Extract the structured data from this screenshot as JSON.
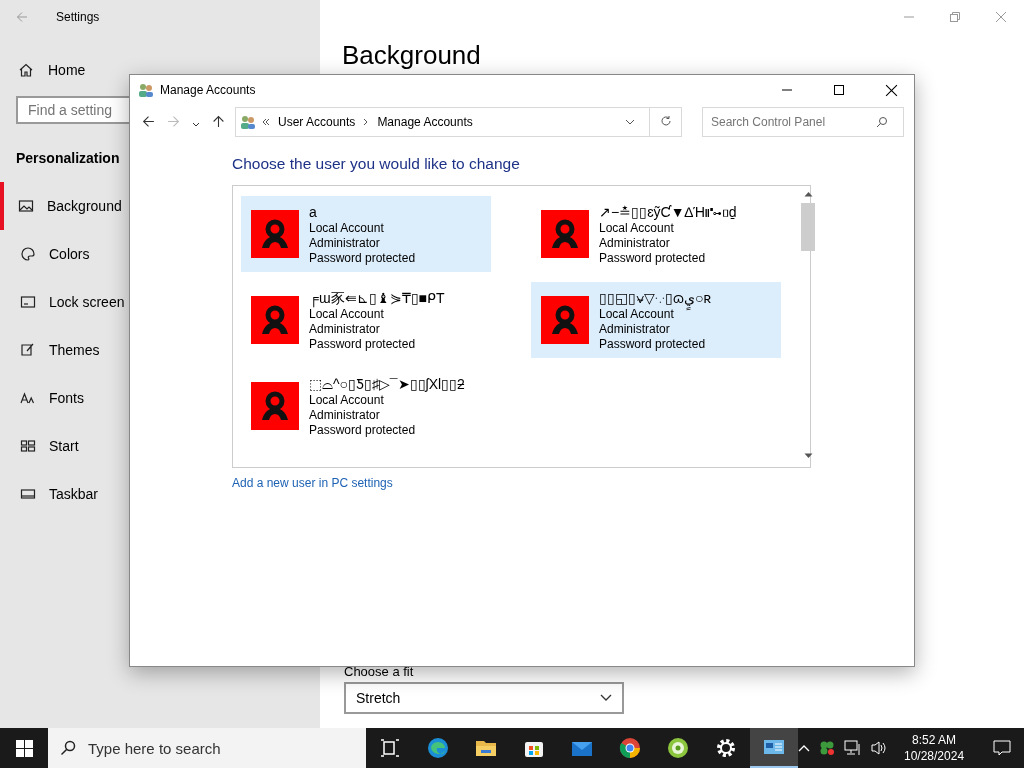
{
  "settings": {
    "title": "Settings",
    "home": "Home",
    "search": {
      "placeholder": "Find a setting"
    },
    "section": "Personalization",
    "items": [
      {
        "label": "Background",
        "selected": true
      },
      {
        "label": "Colors",
        "selected": false
      },
      {
        "label": "Lock screen",
        "selected": false
      },
      {
        "label": "Themes",
        "selected": false
      },
      {
        "label": "Fonts",
        "selected": false
      },
      {
        "label": "Start",
        "selected": false
      },
      {
        "label": "Taskbar",
        "selected": false
      }
    ],
    "page_heading": "Background",
    "fit_label": "Choose a fit",
    "fit_value": "Stretch"
  },
  "dialog": {
    "title": "Manage Accounts",
    "breadcrumb": [
      "User Accounts",
      "Manage Accounts"
    ],
    "search": {
      "placeholder": "Search Control Panel"
    },
    "heading": "Choose the user you would like to change",
    "accounts": [
      {
        "name": "a",
        "type": "Local Account",
        "role": "Administrator",
        "security": "Password protected",
        "highlighted": true
      },
      {
        "name": "↗−≛▯▯ɛỹƇ▼∆Ή⑈⊶▯ḏ",
        "type": "Local Account",
        "role": "Administrator",
        "security": "Password protected",
        "highlighted": false
      },
      {
        "name": "╒ɯ豕⇚⊾▯♝⋟₸▯■ᑭT",
        "type": "Local Account",
        "role": "Administrator",
        "security": "Password protected",
        "highlighted": false
      },
      {
        "name": "▯▯◱▯⍱▽⸪▯ɷيٍ○ʀ",
        "type": "Local Account",
        "role": "Administrator",
        "security": "Password protected",
        "highlighted": true
      },
      {
        "name": "⬚⌓^○▯Ƽ▯♯▷¯➤▯▯ʃXl▯▯ƻ",
        "type": "Local Account",
        "role": "Administrator",
        "security": "Password protected",
        "highlighted": false
      }
    ],
    "link": "Add a new user in PC settings"
  },
  "taskbar": {
    "search": {
      "placeholder": "Type here to search"
    },
    "apps": [
      {
        "active": false
      },
      {
        "active": false
      },
      {
        "active": false
      },
      {
        "active": false
      },
      {
        "active": false
      },
      {
        "active": false
      },
      {
        "active": false
      },
      {
        "active": false
      },
      {
        "active": true
      }
    ],
    "time": "8:52 AM",
    "date": "10/28/2024"
  }
}
